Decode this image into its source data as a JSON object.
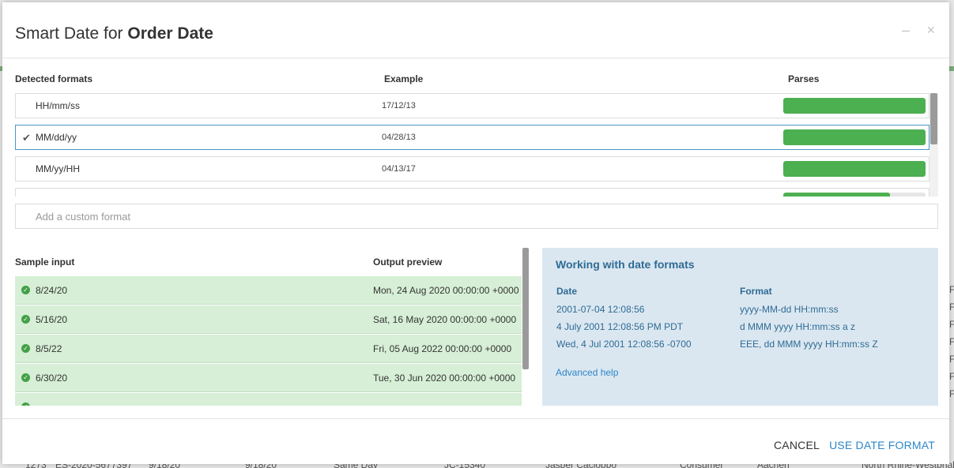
{
  "dialog": {
    "title_prefix": "Smart Date for ",
    "title_field": "Order Date"
  },
  "formats": {
    "headers": {
      "format": "Detected formats",
      "example": "Example",
      "parses": "Parses"
    },
    "rows": [
      {
        "label": "HH/mm/ss",
        "example": "17/12/13",
        "parses": 1.0,
        "selected": false
      },
      {
        "label": "MM/dd/yy",
        "example": "04/28/13",
        "parses": 1.0,
        "selected": true
      },
      {
        "label": "MM/yy/HH",
        "example": "04/13/17",
        "parses": 1.0,
        "selected": false
      },
      {
        "label": "",
        "example": "",
        "parses": 0.75,
        "selected": false
      }
    ],
    "custom_placeholder": "Add a custom format"
  },
  "samples": {
    "headers": {
      "input": "Sample input",
      "output": "Output preview"
    },
    "rows": [
      {
        "input": "8/24/20",
        "output": "Mon, 24 Aug 2020 00:00:00 +0000"
      },
      {
        "input": "5/16/20",
        "output": "Sat, 16 May 2020 00:00:00 +0000"
      },
      {
        "input": "8/5/22",
        "output": "Fri, 05 Aug 2022 00:00:00 +0000"
      },
      {
        "input": "6/30/20",
        "output": "Tue, 30 Jun 2020 00:00:00 +0000"
      },
      {
        "input": "",
        "output": ""
      }
    ]
  },
  "help": {
    "title": "Working with date formats",
    "date_header": "Date",
    "format_header": "Format",
    "examples": [
      {
        "date": "2001-07-04 12:08:56",
        "format": "yyyy-MM-dd HH:mm:ss"
      },
      {
        "date": "4 July 2001 12:08:56 PM PDT",
        "format": "d MMM yyyy HH:mm:ss a z"
      },
      {
        "date": "Wed, 4 Jul 2001 12:08:56 -0700",
        "format": "EEE, dd MMM yyyy HH:mm:ss Z"
      }
    ],
    "advanced_link": "Advanced help"
  },
  "footer": {
    "cancel": "CANCEL",
    "use": "USE DATE FORMAT"
  },
  "background": {
    "bottom_row": [
      "1273",
      "ES-2020-5677397",
      "9/18/20",
      "9/18/20",
      "Same Day",
      "JC-15340",
      "Jasper Cacioppo",
      "Consumer",
      "Aachen",
      "North Rhine-Westphalia"
    ],
    "right_letters": [
      "F",
      "F",
      "F",
      "F",
      "F",
      "F",
      "F"
    ]
  },
  "colors": {
    "accent": "#2e86c9",
    "success": "#4caf50",
    "sample_bg": "#d6efd6",
    "help_bg": "#dbe7f0"
  },
  "icons": {
    "check": "check-icon",
    "success": "success-circle-icon",
    "minimize": "minimize-icon",
    "close": "close-icon"
  }
}
